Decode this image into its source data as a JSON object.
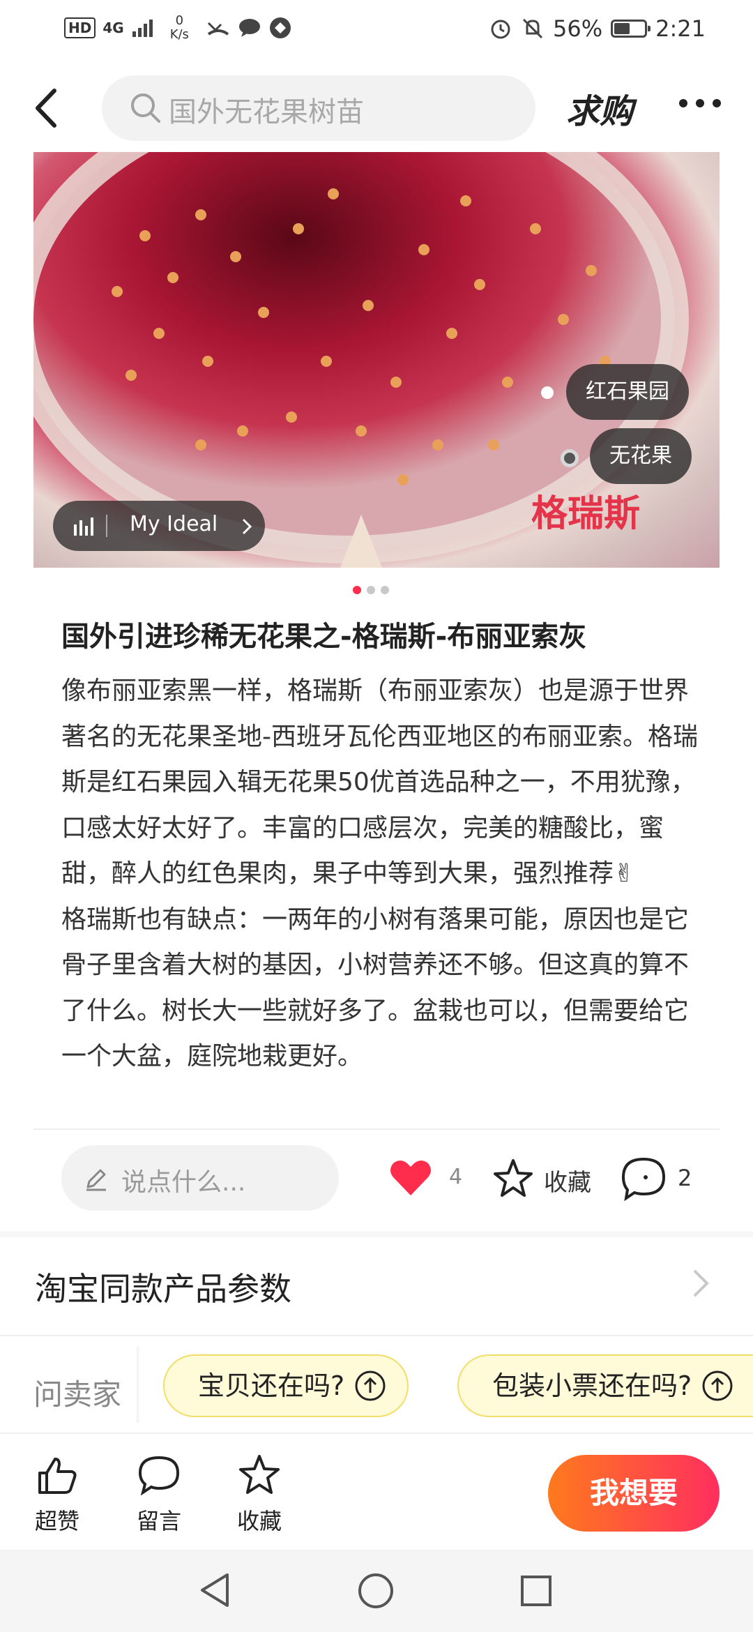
{
  "status_bar": {
    "hd": "HD",
    "network": "4G",
    "speed_value": "0",
    "speed_unit": "K/s",
    "battery_percent": "56%",
    "battery_level": 0.56,
    "time": "2:21"
  },
  "header": {
    "search_placeholder": "国外无花果树苗",
    "buy_label": "求购"
  },
  "hero": {
    "tags": [
      "红石果园",
      "无花果"
    ],
    "overlay_text": "格瑞斯",
    "badge_label": "My Ideal",
    "page_count": 3,
    "active_page": 1
  },
  "post": {
    "title": "国外引进珍稀无花果之-格瑞斯-布丽亚索灰",
    "body": "像布丽亚索黑一样，格瑞斯（布丽亚索灰）也是源于世界著名的无花果圣地-西班牙瓦伦西亚地区的布丽亚索。格瑞斯是红石果园入辑无花果50优首选品种之一，不用犹豫，口感太好太好了。丰富的口感层次，完美的糖酸比，蜜甜，醉人的红色果肉，果子中等到大果，强烈推荐✌\n格瑞斯也有缺点：一两年的小树有落果可能，原因也是它骨子里含着大树的基因，小树营养还不够。但这真的算不了什么。树长大一些就好多了。盆栽也可以，但需要给它一个大盆，庭院地栽更好。"
  },
  "actions": {
    "comment_placeholder": "说点什么...",
    "like_count": "4",
    "fav_label": "收藏",
    "comment_count": "2"
  },
  "params": {
    "label": "淘宝同款产品参数"
  },
  "ask": {
    "label": "问卖家",
    "chips": [
      "宝贝还在吗?",
      "包装小票还在吗?"
    ]
  },
  "bottom_bar": {
    "tabs": [
      {
        "label": "超赞",
        "icon": "thumbs-up-icon"
      },
      {
        "label": "留言",
        "icon": "speech-bubble-icon"
      },
      {
        "label": "收藏",
        "icon": "star-icon"
      }
    ],
    "want_label": "我想要"
  },
  "colors": {
    "accent": "#ff2d4b",
    "want_gradient_start": "#ff7a1e",
    "want_gradient_end": "#ff2e5f",
    "chip_bg": "#fffbd9",
    "chip_border": "#f3de68"
  }
}
